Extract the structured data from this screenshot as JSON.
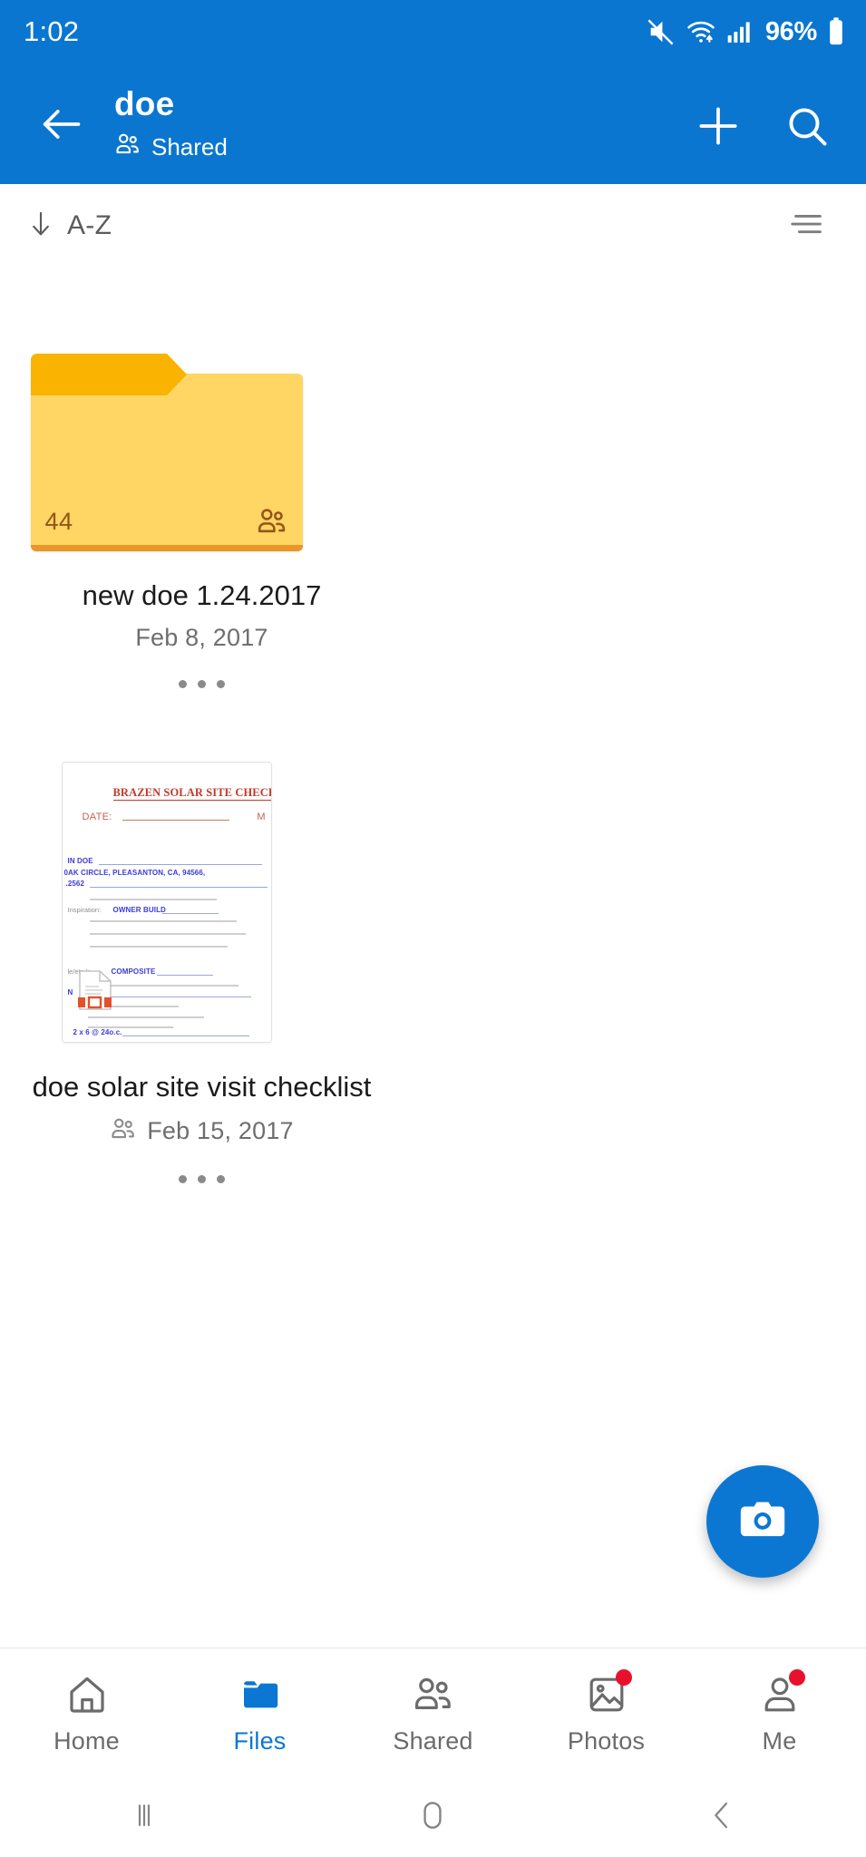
{
  "statusbar": {
    "time": "1:02",
    "battery_percent": "96%",
    "icons": [
      "mute-icon",
      "wifi-icon",
      "cellular-signal-icon",
      "battery-icon"
    ]
  },
  "appbar": {
    "back_icon": "back-arrow-icon",
    "title": "doe",
    "subtitle": "Shared",
    "subtitle_icon": "people-icon",
    "add_icon": "plus-icon",
    "search_icon": "search-icon",
    "background": "#0a76d0"
  },
  "sortbar": {
    "sort_label": "A-Z",
    "sort_direction_icon": "arrow-down-icon",
    "view_toggle_icon": "list-view-icon"
  },
  "items": [
    {
      "type": "folder",
      "name": "new doe 1.24.2017",
      "date": "Feb 8, 2017",
      "child_count": "44",
      "shared": true,
      "shared_icon": "people-icon",
      "more_icon": "more-options-icon",
      "colors": {
        "tab": "#f9b300",
        "body": "#ffd563",
        "edge": "#e9962b",
        "count_text": "#96541b"
      }
    },
    {
      "type": "file",
      "name": "doe solar site visit checklist",
      "date": "Feb 15, 2017",
      "shared": true,
      "shared_icon": "people-icon",
      "more_icon": "more-options-icon",
      "thumbnail": {
        "heading": "BRAZEN SOLAR SITE CHECKL",
        "date_label": "DATE:",
        "right_marker": "M",
        "blue_lines": [
          "IN DOE",
          "0AK CIRCLE, PLEASANTON, CA, 94566,",
          ".2562"
        ],
        "form_rows": [
          {
            "label": "Inspiration:",
            "value": "OWNER BUILD"
          },
          {
            "label": "le/etc.):",
            "value": "COMPOSITE"
          }
        ],
        "short_blue": "N",
        "footer_note": "2 x 6 @ 24o.c.",
        "overlay_icon": "pdf-document-icon"
      }
    }
  ],
  "fab": {
    "icon": "camera-icon",
    "color": "#0c77d2"
  },
  "bottomnav": {
    "active_color": "#0c77d2",
    "items": [
      {
        "label": "Home",
        "icon": "home-icon",
        "active": false,
        "badge": false
      },
      {
        "label": "Files",
        "icon": "folder-icon",
        "active": true,
        "badge": false
      },
      {
        "label": "Shared",
        "icon": "people-icon",
        "active": false,
        "badge": false
      },
      {
        "label": "Photos",
        "icon": "photo-icon",
        "active": false,
        "badge": true
      },
      {
        "label": "Me",
        "icon": "person-icon",
        "active": false,
        "badge": true
      }
    ]
  },
  "sysnav": {
    "recents_icon": "recents-icon",
    "home_icon": "home-circle-icon",
    "back_icon": "back-chevron-icon"
  }
}
